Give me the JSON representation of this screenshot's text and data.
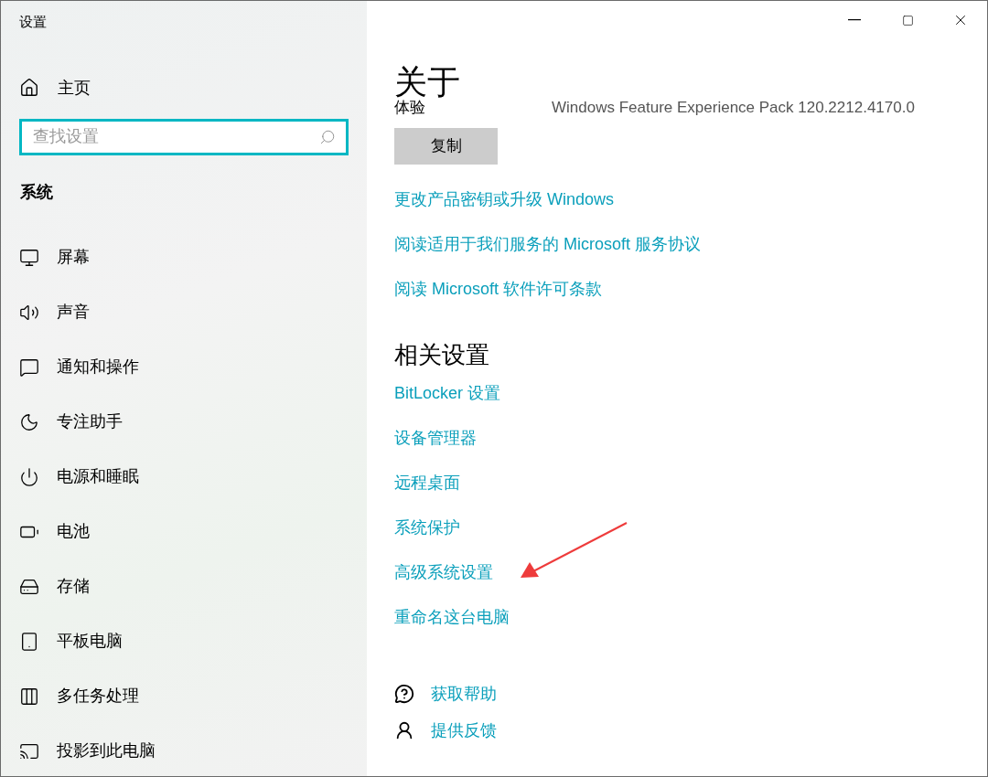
{
  "window": {
    "title": "设置"
  },
  "sidebar": {
    "home": "主页",
    "search": {
      "placeholder": "查找设置"
    },
    "section": "系统",
    "items": [
      {
        "label": "屏幕"
      },
      {
        "label": "声音"
      },
      {
        "label": "通知和操作"
      },
      {
        "label": "专注助手"
      },
      {
        "label": "电源和睡眠"
      },
      {
        "label": "电池"
      },
      {
        "label": "存储"
      },
      {
        "label": "平板电脑"
      },
      {
        "label": "多任务处理"
      },
      {
        "label": "投影到此电脑"
      }
    ]
  },
  "content": {
    "title": "关于",
    "spec_row": {
      "label": "体验",
      "value": "Windows Feature Experience Pack 120.2212.4170.0"
    },
    "copy_button": "复制",
    "links": [
      "更改产品密钥或升级 Windows",
      "阅读适用于我们服务的 Microsoft 服务协议",
      "阅读 Microsoft 软件许可条款"
    ],
    "related_title": "相关设置",
    "related_links": [
      "BitLocker 设置",
      "设备管理器",
      "远程桌面",
      "系统保护",
      "高级系统设置",
      "重命名这台电脑"
    ],
    "help_links": [
      "获取帮助",
      "提供反馈"
    ]
  }
}
